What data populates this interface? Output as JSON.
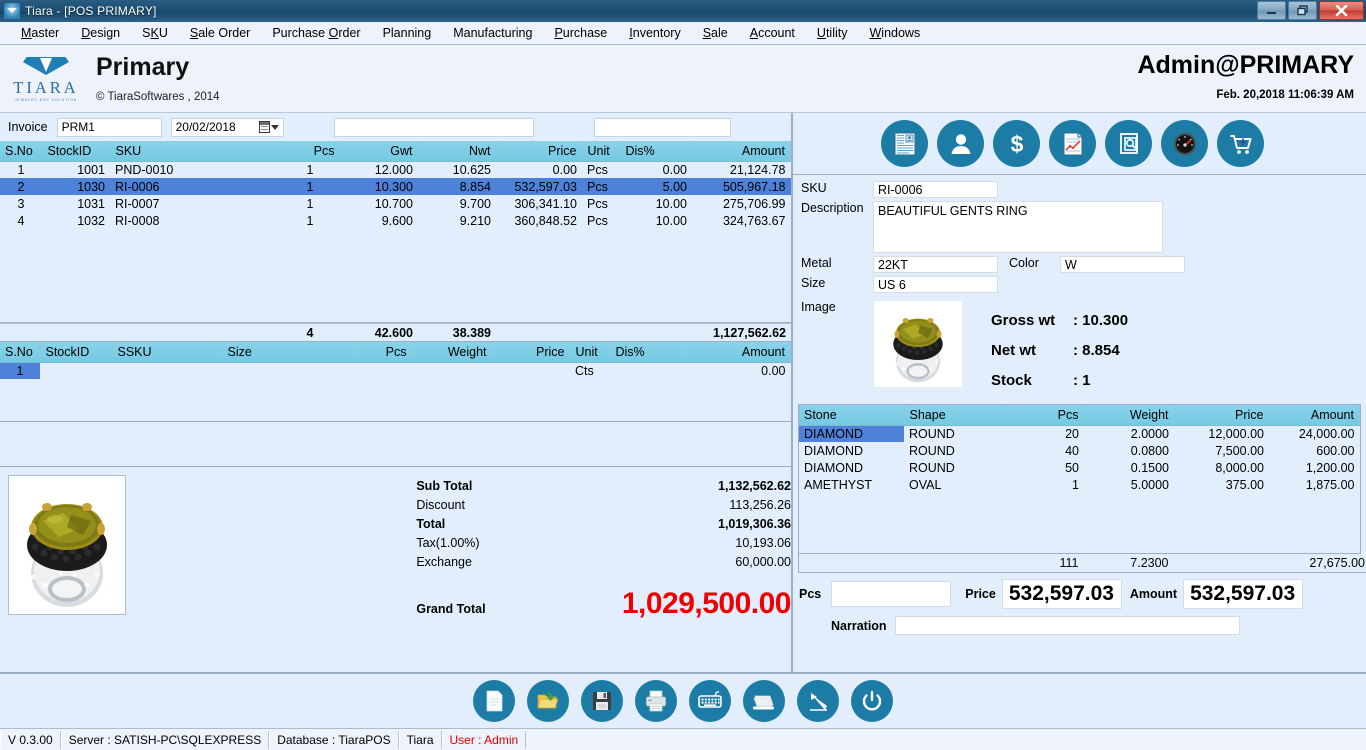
{
  "window": {
    "title": "Tiara - [POS PRIMARY]",
    "minimize": "–",
    "maximize": "❐",
    "close": "✕"
  },
  "menubar": [
    {
      "label": "Master"
    },
    {
      "label": "Design"
    },
    {
      "label": "SKU"
    },
    {
      "label": "Sale Order"
    },
    {
      "label": "Purchase Order"
    },
    {
      "label": "Planning"
    },
    {
      "label": "Manufacturing"
    },
    {
      "label": "Purchase"
    },
    {
      "label": "Inventory"
    },
    {
      "label": "Sale"
    },
    {
      "label": "Account"
    },
    {
      "label": "Utility"
    },
    {
      "label": "Windows"
    }
  ],
  "header": {
    "logo_text": "TIARA",
    "logo_sub": "JEWELRY ERP SOLUTION",
    "title": "Primary",
    "copyright": "©  TiaraSoftwares , 2014",
    "user": "Admin@PRIMARY",
    "datetime": "Feb. 20,2018 11:06:39 AM"
  },
  "invoice": {
    "label": "Invoice",
    "number": "PRM1",
    "date": "20/02/2018",
    "blank_field_1": "",
    "blank_field_2": ""
  },
  "items_grid": {
    "columns": [
      "S.No",
      "StockID",
      "SKU",
      "Pcs",
      "Gwt",
      "Nwt",
      "Price",
      "Unit",
      "Dis%",
      "Amount"
    ],
    "rows": [
      {
        "sno": "1",
        "stockid": "1001",
        "sku": "PND-0010",
        "pcs": "1",
        "gwt": "12.000",
        "nwt": "10.625",
        "price": "0.00",
        "unit": "Pcs",
        "dis": "0.00",
        "amount": "21,124.78",
        "selected": false
      },
      {
        "sno": "2",
        "stockid": "1030",
        "sku": "RI-0006",
        "pcs": "1",
        "gwt": "10.300",
        "nwt": "8.854",
        "price": "532,597.03",
        "unit": "Pcs",
        "dis": "5.00",
        "amount": "505,967.18",
        "selected": true
      },
      {
        "sno": "3",
        "stockid": "1031",
        "sku": "RI-0007",
        "pcs": "1",
        "gwt": "10.700",
        "nwt": "9.700",
        "price": "306,341.10",
        "unit": "Pcs",
        "dis": "10.00",
        "amount": "275,706.99",
        "selected": false
      },
      {
        "sno": "4",
        "stockid": "1032",
        "sku": "RI-0008",
        "pcs": "1",
        "gwt": "9.600",
        "nwt": "9.210",
        "price": "360,848.52",
        "unit": "Pcs",
        "dis": "10.00",
        "amount": "324,763.67",
        "selected": false
      }
    ],
    "totals": {
      "pcs": "4",
      "gwt": "42.600",
      "nwt": "38.389",
      "amount": "1,127,562.62"
    }
  },
  "stone_grid_left": {
    "columns": [
      "S.No",
      "StockID",
      "SSKU",
      "Size",
      "Pcs",
      "Weight",
      "Price",
      "Unit",
      "Dis%",
      "Amount"
    ],
    "rows": [
      {
        "sno": "1",
        "stockid": "",
        "ssku": "",
        "size": "",
        "pcs": "",
        "weight": "",
        "price": "",
        "unit": "Cts",
        "dis": "",
        "amount": "0.00",
        "selected": true
      }
    ]
  },
  "summary": {
    "sub_total_label": "Sub Total",
    "sub_total_value": "1,132,562.62",
    "discount_label": "Discount",
    "discount_value": "113,256.26",
    "total_label": "Total",
    "total_value": "1,019,306.36",
    "tax_label": "Tax(1.00%)",
    "tax_value": "10,193.06",
    "exchange_label": "Exchange",
    "exchange_value": "60,000.00",
    "grand_total_label": "Grand Total",
    "grand_total_value": "1,029,500.00",
    "grand_total_color": "#ee0000"
  },
  "right_toolbar": [
    {
      "name": "invoice-list-icon",
      "title": "Invoice"
    },
    {
      "name": "customer-icon",
      "title": "Customer"
    },
    {
      "name": "dollar-icon",
      "title": "Payment"
    },
    {
      "name": "report-icon",
      "title": "Report"
    },
    {
      "name": "search-document-icon",
      "title": "Search"
    },
    {
      "name": "gauge-icon",
      "title": "Dashboard"
    },
    {
      "name": "cart-icon",
      "title": "Cart"
    }
  ],
  "product": {
    "sku_label": "SKU",
    "sku_value": "RI-0006",
    "description_label": "Description",
    "description_value": "BEAUTIFUL GENTS RING",
    "metal_label": "Metal",
    "metal_value": "22KT",
    "color_label": "Color",
    "color_value": "W",
    "size_label": "Size",
    "size_value": "US 6",
    "image_label": "Image",
    "gross_wt_label": "Gross wt",
    "gross_wt_value": ": 10.300",
    "net_wt_label": "Net wt",
    "net_wt_value": ": 8.854",
    "stock_label": "Stock",
    "stock_value": ": 1"
  },
  "stones_grid": {
    "columns": [
      "Stone",
      "Shape",
      "Pcs",
      "Weight",
      "Price",
      "Amount"
    ],
    "rows": [
      {
        "stone": "DIAMOND",
        "shape": "ROUND",
        "pcs": "20",
        "weight": "2.0000",
        "price": "12,000.00",
        "amount": "24,000.00",
        "selected": true
      },
      {
        "stone": "DIAMOND",
        "shape": "ROUND",
        "pcs": "40",
        "weight": "0.0800",
        "price": "7,500.00",
        "amount": "600.00",
        "selected": false
      },
      {
        "stone": "DIAMOND",
        "shape": "ROUND",
        "pcs": "50",
        "weight": "0.1500",
        "price": "8,000.00",
        "amount": "1,200.00",
        "selected": false
      },
      {
        "stone": "AMETHYST",
        "shape": "OVAL",
        "pcs": "1",
        "weight": "5.0000",
        "price": "375.00",
        "amount": "1,875.00",
        "selected": false
      }
    ],
    "totals": {
      "pcs": "111",
      "weight": "7.2300",
      "amount": "27,675.00"
    }
  },
  "price_amount": {
    "pcs_label": "Pcs",
    "pcs_value": "",
    "price_label": "Price",
    "price_value": "532,597.03",
    "amount_label": "Amount",
    "amount_value": "532,597.03",
    "narration_label": "Narration",
    "narration_value": ""
  },
  "bottom_toolbar": [
    {
      "name": "new-document-icon",
      "title": "New"
    },
    {
      "name": "open-folder-icon",
      "title": "Open"
    },
    {
      "name": "save-floppy-icon",
      "title": "Save"
    },
    {
      "name": "print-icon",
      "title": "Print"
    },
    {
      "name": "keyboard-icon",
      "title": "Keyboard"
    },
    {
      "name": "card-swipe-icon",
      "title": "Card"
    },
    {
      "name": "chart-arrow-icon",
      "title": "Chart"
    },
    {
      "name": "power-icon",
      "title": "Exit"
    }
  ],
  "statusbar": {
    "version": "V 0.3.00",
    "server": "Server : SATISH-PC\\SQLEXPRESS",
    "database": "Database : TiaraPOS",
    "company": "Tiara",
    "user": "User : Admin",
    "user_color": "#e00000"
  }
}
